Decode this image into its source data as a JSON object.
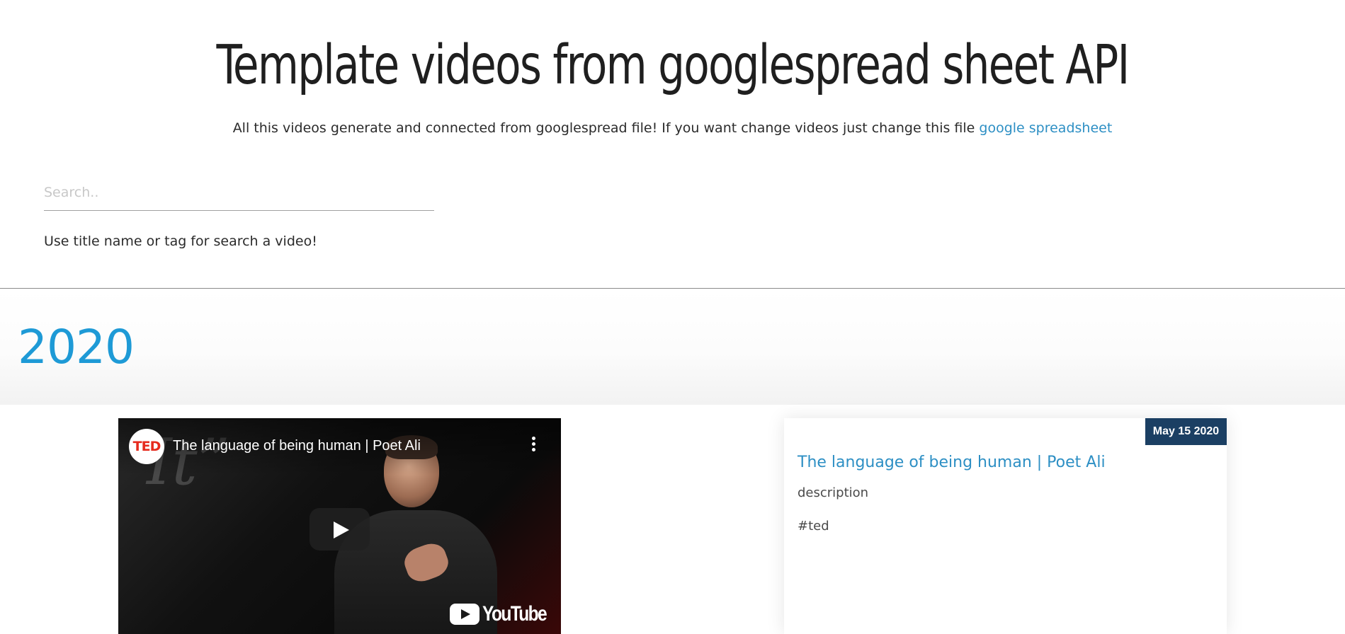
{
  "header": {
    "title": "Template videos from googlespread sheet API",
    "subtitle_text": "All this videos generate and connected from googlespread file! If you want change videos just change this file ",
    "subtitle_link": "google spreadsheet"
  },
  "search": {
    "placeholder": "Search..",
    "value": "",
    "hint": "Use title name or tag for search a video!"
  },
  "year_section": {
    "year": "2020"
  },
  "video": {
    "channel_logo_text": "TED",
    "title": "The language of being human | Poet Ali",
    "background_text": "It”",
    "brand": "YouTube",
    "icons": [
      "ted-logo-icon",
      "kebab-menu-icon",
      "play-icon",
      "youtube-logo-icon"
    ]
  },
  "card": {
    "date": "May 15 2020",
    "title": "The language of being human | Poet Ali",
    "description": "description",
    "tag": "#ted"
  },
  "colors": {
    "link": "#2d8fc4",
    "year": "#1e9ad6",
    "date_badge_bg": "#1b3f63"
  }
}
